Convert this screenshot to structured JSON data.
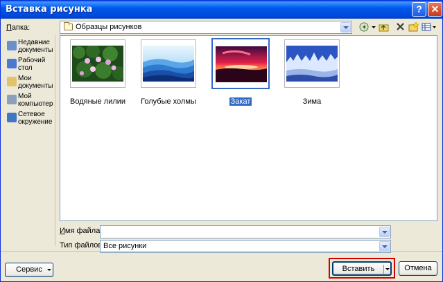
{
  "window": {
    "title": "Вставка рисунка"
  },
  "titlebar_buttons": {
    "help": "?",
    "close": "✕"
  },
  "location": {
    "label_prefix": "П",
    "label_rest": "апка:",
    "value": "Образцы рисунков"
  },
  "toolbar": {
    "back_icon": "back-icon",
    "up_icon": "up-folder-icon",
    "delete_icon": "delete-icon",
    "new_folder_icon": "new-folder-icon",
    "views_icon": "views-icon"
  },
  "places": [
    {
      "label_line1": "Недавние",
      "label_line2": "документы",
      "icon": "recent-documents-icon",
      "color": "#6b8fc8"
    },
    {
      "label_line1": "Рабочий",
      "label_line2": "стол",
      "icon": "desktop-icon",
      "color": "#4a7bd0"
    },
    {
      "label_line1": "Мои",
      "label_line2": "документы",
      "icon": "my-documents-icon",
      "color": "#e3c36a"
    },
    {
      "label_line1": "Мой",
      "label_line2": "компьютер",
      "icon": "my-computer-icon",
      "color": "#8ca0bd"
    },
    {
      "label_line1": "Сетевое",
      "label_line2": "окружение",
      "icon": "network-icon",
      "color": "#3f77c4"
    }
  ],
  "files": [
    {
      "name": "Водяные лилии",
      "selected": false
    },
    {
      "name": "Голубые холмы",
      "selected": false
    },
    {
      "name": "Закат",
      "selected": true
    },
    {
      "name": "Зима",
      "selected": false
    }
  ],
  "filename": {
    "label_prefix": "И",
    "label_rest": "мя файла:",
    "value": ""
  },
  "filetype": {
    "label": "Тип файлов:",
    "value": "Все рисунки"
  },
  "buttons": {
    "tools": "Сервис",
    "insert": "Вставить",
    "cancel": "Отмена"
  },
  "colors": {
    "titlebar": "#0058ee",
    "selection": "#316ac5",
    "highlight_frame": "#d40000"
  }
}
